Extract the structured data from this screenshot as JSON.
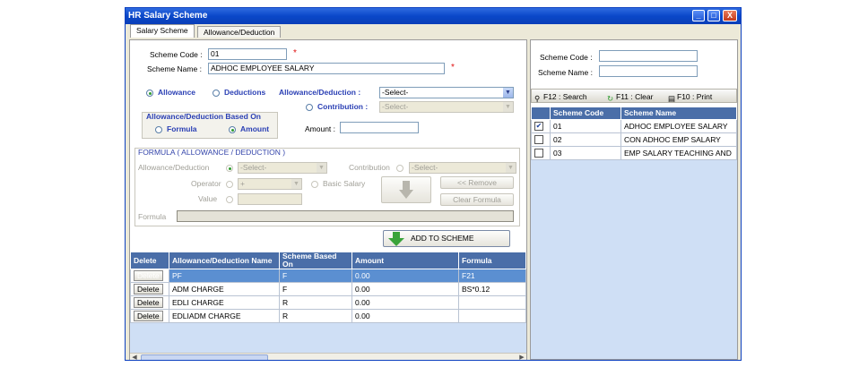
{
  "window": {
    "title": "HR Salary Scheme",
    "controls": [
      "_",
      "□",
      "X"
    ]
  },
  "tabs": [
    {
      "label": "Salary Scheme",
      "active": true
    },
    {
      "label": "Allowance/Deduction",
      "active": false
    }
  ],
  "form": {
    "scheme_code_label": "Scheme Code :",
    "scheme_code_value": "01",
    "scheme_name_label": "Scheme Name :",
    "scheme_name_value": "ADHOC EMPLOYEE SALARY",
    "required_mark": "*",
    "type_allowance": "Allowance",
    "type_deductions": "Deductions",
    "allow_ded_label": "Allowance/Deduction :",
    "allow_ded_select": "-Select-",
    "contribution_label": "Contribution :",
    "contribution_select": "-Select-",
    "based_on_title": "Allowance/Deduction Based On",
    "based_formula": "Formula",
    "based_amount": "Amount",
    "amount_label": "Amount :",
    "amount_value": ""
  },
  "formula": {
    "title": "FORMULA  ( ALLOWANCE / DEDUCTION )",
    "allow_ded_label": "Allowance/Deduction",
    "allow_ded_select": "-Select-",
    "contribution_label": "Contribution",
    "contribution_select": "-Select-",
    "operator_label": "Operator",
    "operator_value": "+",
    "basic_salary_label": "Basic Salary",
    "value_label": "Value",
    "remove_button": "<< Remove",
    "clear_button": "Clear Formula",
    "formula_label": "Formula"
  },
  "add_button": "ADD TO SCHEME",
  "left_grid": {
    "headers": [
      "Delete",
      "Allowance/Deduction Name",
      "Scheme Based On",
      "Amount",
      "Formula"
    ],
    "delete_label": "Delete",
    "rows": [
      {
        "name": "PF",
        "based": "F",
        "amount": "0.00",
        "formula": "F21",
        "selected": true
      },
      {
        "name": "ADM CHARGE",
        "based": "F",
        "amount": "0.00",
        "formula": "BS*0.12",
        "selected": false
      },
      {
        "name": "EDLI CHARGE",
        "based": "R",
        "amount": "0.00",
        "formula": "",
        "selected": false
      },
      {
        "name": "EDLIADM CHARGE",
        "based": "R",
        "amount": "0.00",
        "formula": "",
        "selected": false
      }
    ]
  },
  "search": {
    "scheme_code_label": "Scheme Code :",
    "scheme_name_label": "Scheme Name :",
    "search_btn": "F12 : Search",
    "clear_btn": "F11 : Clear",
    "print_btn": "F10 : Print"
  },
  "right_grid": {
    "headers": [
      "",
      "Scheme Code",
      "Scheme Name"
    ],
    "rows": [
      {
        "code": "01",
        "name": "ADHOC EMPLOYEE SALARY",
        "checked": true
      },
      {
        "code": "02",
        "name": "CON ADHOC EMP SALARY",
        "checked": false
      },
      {
        "code": "03",
        "name": "EMP SALARY TEACHING AND",
        "checked": false
      }
    ]
  }
}
